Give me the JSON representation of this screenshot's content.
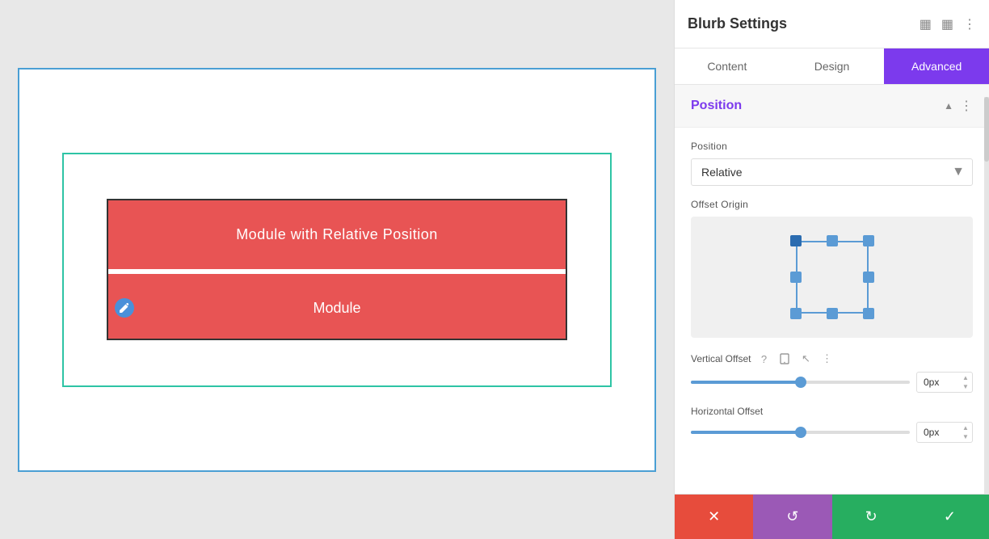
{
  "panel": {
    "title": "Blurb Settings",
    "tabs": [
      {
        "label": "Content",
        "active": false
      },
      {
        "label": "Design",
        "active": false
      },
      {
        "label": "Advanced",
        "active": true
      }
    ],
    "section": {
      "title": "Position",
      "position_label": "Position",
      "position_value": "Relative",
      "offset_origin_label": "Offset Origin",
      "vertical_offset_label": "Vertical Offset",
      "vertical_offset_value": "0px",
      "horizontal_offset_label": "Horizontal Offset",
      "horizontal_offset_value": "0px"
    }
  },
  "canvas": {
    "module_top_text": "Module with Relative Position",
    "module_bottom_text": "Module"
  },
  "footer": {
    "cancel_icon": "✕",
    "reset_icon": "↺",
    "redo_icon": "↻",
    "confirm_icon": "✓"
  },
  "icons": {
    "fullscreen": "⛶",
    "columns": "⊞",
    "more": "⋮",
    "chevron_up": "▲",
    "more_vert": "⋮",
    "question": "?",
    "tablet": "▣",
    "cursor": "↖"
  }
}
